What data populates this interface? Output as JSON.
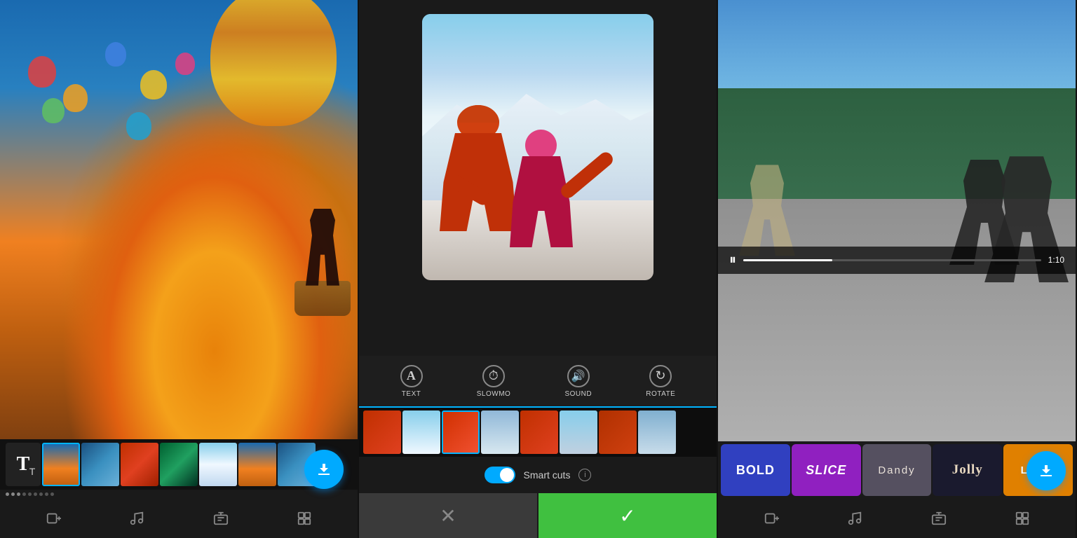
{
  "panels": [
    {
      "id": "panel-balloon",
      "timeline": {
        "thumbs": [
          "balloon",
          "sky",
          "red",
          "green",
          "snow",
          "balloon",
          "sky"
        ]
      },
      "toolbar": {
        "items": [
          {
            "id": "add-clip",
            "label": ""
          },
          {
            "id": "music",
            "label": ""
          },
          {
            "id": "clips",
            "label": ""
          },
          {
            "id": "settings",
            "label": ""
          }
        ]
      },
      "fab": {
        "label": ""
      }
    },
    {
      "id": "panel-ski",
      "tools": [
        {
          "id": "text",
          "label": "TEXT",
          "icon": "A"
        },
        {
          "id": "slowmo",
          "label": "SLOWMO",
          "icon": "⏱"
        },
        {
          "id": "sound",
          "label": "SOUND",
          "icon": "🔊"
        },
        {
          "id": "rotate",
          "label": "ROTATE",
          "icon": "↻"
        }
      ],
      "smart_cuts": {
        "label": "Smart cuts",
        "enabled": true
      },
      "cancel_label": "✕",
      "confirm_label": "✓"
    },
    {
      "id": "panel-skate",
      "playback": {
        "time": "1:10"
      },
      "themes": [
        {
          "id": "bold",
          "label": "BOLD",
          "style": "bold"
        },
        {
          "id": "slice",
          "label": "SLICE",
          "style": "slice"
        },
        {
          "id": "dandy",
          "label": "Dandy",
          "style": "dandy"
        },
        {
          "id": "jolly",
          "label": "Jolly",
          "style": "jolly"
        },
        {
          "id": "light",
          "label": "LIGHT",
          "style": "light"
        }
      ],
      "toolbar": {
        "items": [
          {
            "id": "add-clip",
            "label": ""
          },
          {
            "id": "music",
            "label": ""
          },
          {
            "id": "clips",
            "label": ""
          },
          {
            "id": "settings",
            "label": ""
          }
        ]
      },
      "fab": {
        "label": ""
      }
    }
  ]
}
